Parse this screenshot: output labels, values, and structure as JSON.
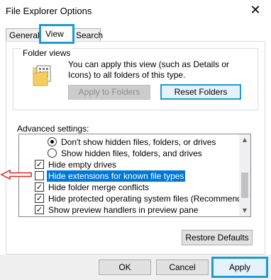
{
  "window": {
    "title": "File Explorer Options",
    "close_icon": "close-icon"
  },
  "tabs": [
    {
      "label": "General"
    },
    {
      "label": "View"
    },
    {
      "label": "Search"
    }
  ],
  "folder_views": {
    "label": "Folder views",
    "description": "You can apply this view (such as Details or Icons) to all folders of this type.",
    "apply_button": "Apply to Folders",
    "reset_button": "Reset Folders"
  },
  "advanced": {
    "label": "Advanced settings:",
    "items": [
      {
        "type": "radio",
        "checked": true,
        "label": "Don't show hidden files, folders, or drives"
      },
      {
        "type": "radio",
        "checked": false,
        "label": "Show hidden files, folders, and drives"
      },
      {
        "type": "checkbox",
        "checked": true,
        "label": "Hide empty drives"
      },
      {
        "type": "checkbox",
        "checked": false,
        "label": "Hide extensions for known file types",
        "selected": true
      },
      {
        "type": "checkbox",
        "checked": true,
        "label": "Hide folder merge conflicts"
      },
      {
        "type": "checkbox",
        "checked": true,
        "label": "Hide protected operating system files (Recommended)"
      },
      {
        "type": "checkbox",
        "checked": true,
        "label": "Show preview handlers in preview pane"
      }
    ],
    "restore_button": "Restore Defaults"
  },
  "footer": {
    "ok": "OK",
    "cancel": "Cancel",
    "apply": "Apply"
  },
  "colors": {
    "accent": "#1e9bd7",
    "selection": "#0078d7",
    "pointer": "#e02020"
  }
}
